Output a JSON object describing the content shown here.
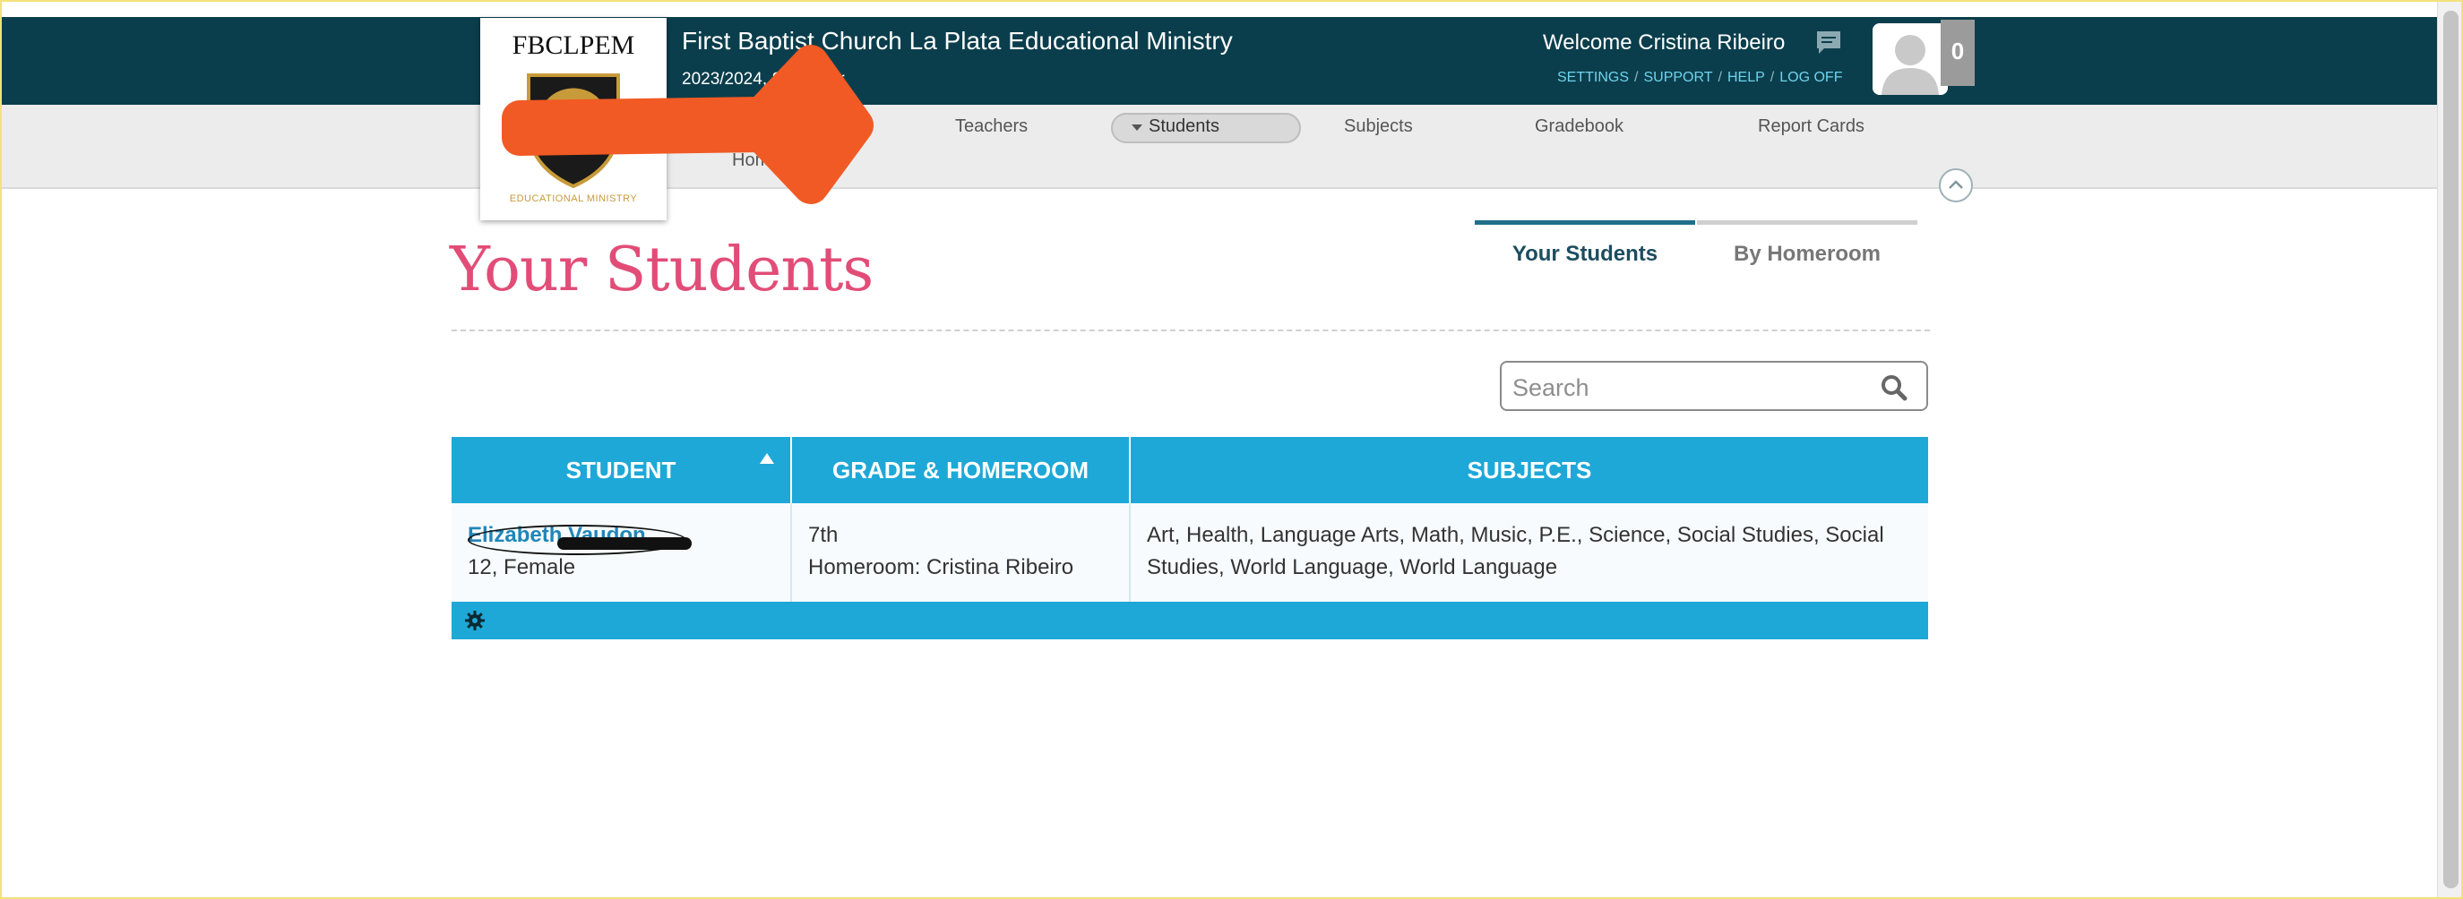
{
  "header": {
    "school_name": "First Baptist Church La Plata Educational Ministry",
    "term": "2023/2024, Semester",
    "welcome": "Welcome Cristina Ribeiro",
    "notification_count": "0",
    "links": [
      "SETTINGS",
      "SUPPORT",
      "HELP",
      "LOG OFF"
    ]
  },
  "logo": {
    "abbrev": "FBCLPEM",
    "tagline": "EDUCATIONAL MINISTRY"
  },
  "nav": {
    "items": [
      "Teachers",
      "Students",
      "Subjects",
      "Gradebook",
      "Report Cards",
      "Homework"
    ],
    "active": "Students"
  },
  "page": {
    "title": "Your Students",
    "tabs": [
      "Your Students",
      "By Homeroom"
    ],
    "active_tab": "Your Students"
  },
  "search": {
    "placeholder": "Search"
  },
  "table": {
    "headers": [
      "STUDENT",
      "GRADE & HOMEROOM",
      "SUBJECTS"
    ],
    "rows": [
      {
        "student_name": "Elizabeth Vaudon",
        "student_details": "12, Female",
        "grade": "7th",
        "homeroom": "Homeroom: Cristina Ribeiro",
        "subjects": "Art, Health, Language Arts, Math, Music, P.E., Science, Social Studies, Social Studies, World Language, World Language"
      }
    ]
  },
  "colors": {
    "header_bg": "#0b3e4c",
    "accent_blue": "#1ea8d8",
    "title_pink": "#e24d78",
    "arrow_orange": "#f15a24"
  }
}
